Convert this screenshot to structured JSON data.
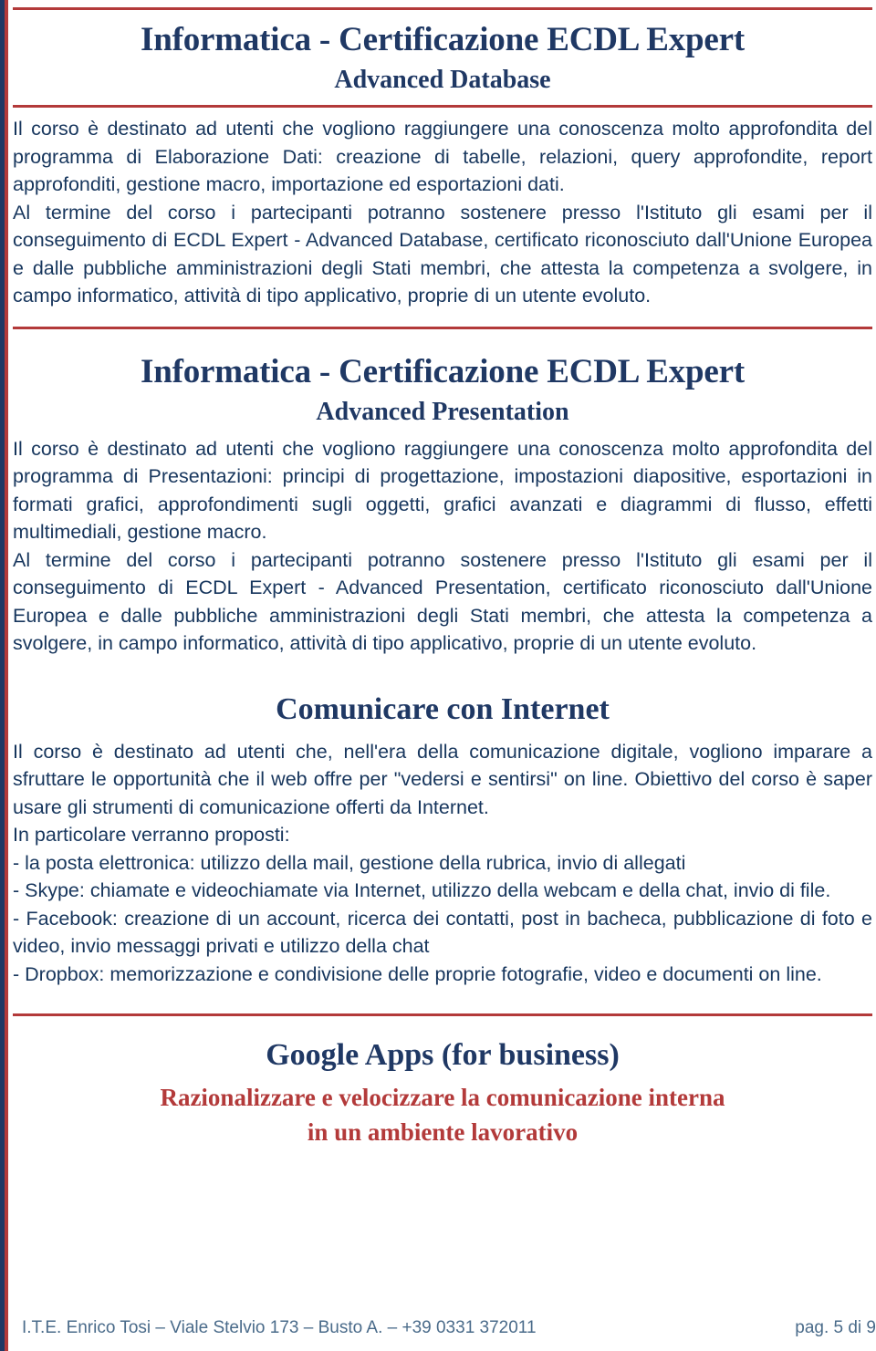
{
  "document": {
    "accent_navy": "#1f3864",
    "accent_red": "#b33a3a",
    "body_color": "#17365d"
  },
  "sections": [
    {
      "title": "Informatica - Certificazione ECDL Expert",
      "subtitle": "Advanced Database",
      "paragraphs": [
        "Il corso è destinato ad utenti che vogliono raggiungere una conoscenza molto approfondita del programma di Elaborazione Dati: creazione di tabelle, relazioni, query approfondite, report approfonditi, gestione macro, importazione ed esportazioni dati.",
        "Al termine del corso i partecipanti potranno sostenere presso l'Istituto gli esami per il conseguimento di ECDL Expert - Advanced Database, certificato riconosciuto dall'Unione Europea e dalle pubbliche amministrazioni degli Stati membri, che attesta la competenza a svolgere, in campo informatico, attività di tipo applicativo, proprie di un utente evoluto."
      ]
    },
    {
      "title": "Informatica - Certificazione ECDL Expert",
      "subtitle": "Advanced Presentation",
      "paragraphs": [
        "Il corso è destinato ad utenti che vogliono raggiungere una conoscenza molto approfondita del programma di Presentazioni: principi di progettazione, impostazioni diapositive, esportazioni in formati grafici, approfondimenti sugli oggetti, grafici avanzati e diagrammi di flusso, effetti multimediali, gestione macro.",
        "Al termine del corso i partecipanti potranno sostenere presso l'Istituto gli esami per il conseguimento di ECDL Expert - Advanced Presentation, certificato riconosciuto dall'Unione Europea e dalle pubbliche amministrazioni degli Stati membri, che attesta la competenza a svolgere, in campo informatico, attività di tipo applicativo, proprie di un utente evoluto."
      ]
    },
    {
      "title": "Comunicare con Internet",
      "subtitle": "",
      "paragraphs": [
        "Il corso è destinato ad utenti che, nell'era della comunicazione digitale, vogliono imparare a sfruttare le opportunità che il web offre per \"vedersi e sentirsi\" on line. Obiettivo del corso è saper usare gli strumenti di comunicazione offerti da Internet.",
        "In particolare verranno proposti:",
        "- la posta elettronica: utilizzo della mail, gestione della rubrica, invio di allegati",
        "- Skype: chiamate e videochiamate via Internet, utilizzo della webcam e della chat, invio di file.",
        "- Facebook: creazione di un account, ricerca dei contatti, post in bacheca, pubblicazione di foto e video, invio messaggi privati e utilizzo della chat",
        "- Dropbox: memorizzazione e condivisione delle proprie fotografie, video e documenti on line."
      ]
    },
    {
      "title": "Google Apps (for business)",
      "sub_red_1": "Razionalizzare e velocizzare la comunicazione interna",
      "sub_red_2": "in un ambiente lavorativo"
    }
  ],
  "footer": {
    "institution": "I.T.E. Enrico Tosi  –  Viale Stelvio 173 – Busto A.  –  +39 0331 372011",
    "page_number": "pag. 5 di 9"
  }
}
